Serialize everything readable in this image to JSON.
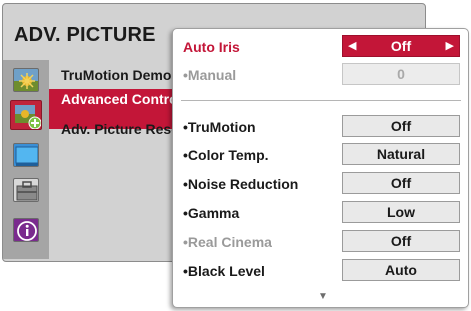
{
  "back_menu": {
    "title": "ADV. PICTURE",
    "items": [
      {
        "label": "TruMotion Demo"
      },
      {
        "label": "Advanced Control"
      },
      {
        "label": "Adv. Picture Reset"
      }
    ],
    "side_icons": [
      "landscape-icon",
      "picture-settings-icon",
      "screen-icon",
      "toolbox-icon",
      "info-icon"
    ]
  },
  "submenu": {
    "rows": [
      {
        "label": "Auto Iris",
        "value": "Off",
        "state": "selected"
      },
      {
        "label": "•Manual",
        "value": "0",
        "state": "disabled"
      },
      {
        "label": "•TruMotion",
        "value": "Off",
        "state": "normal"
      },
      {
        "label": "•Color Temp.",
        "value": "Natural",
        "state": "normal"
      },
      {
        "label": "•Noise Reduction",
        "value": "Off",
        "state": "normal"
      },
      {
        "label": "•Gamma",
        "value": "Low",
        "state": "normal"
      },
      {
        "label": "•Real Cinema",
        "value": "Off",
        "state": "dim-label"
      },
      {
        "label": "•Black Level",
        "value": "Auto",
        "state": "normal"
      }
    ],
    "arrows": {
      "left": "◀",
      "right": "▶"
    },
    "scroll_indicator": "▼"
  },
  "colors": {
    "accent": "#c31638",
    "panel_back": "#d2d2d2",
    "value_box": "#e9e9e9",
    "text": "#1a1a1a",
    "disabled": "#9a9a9a"
  }
}
